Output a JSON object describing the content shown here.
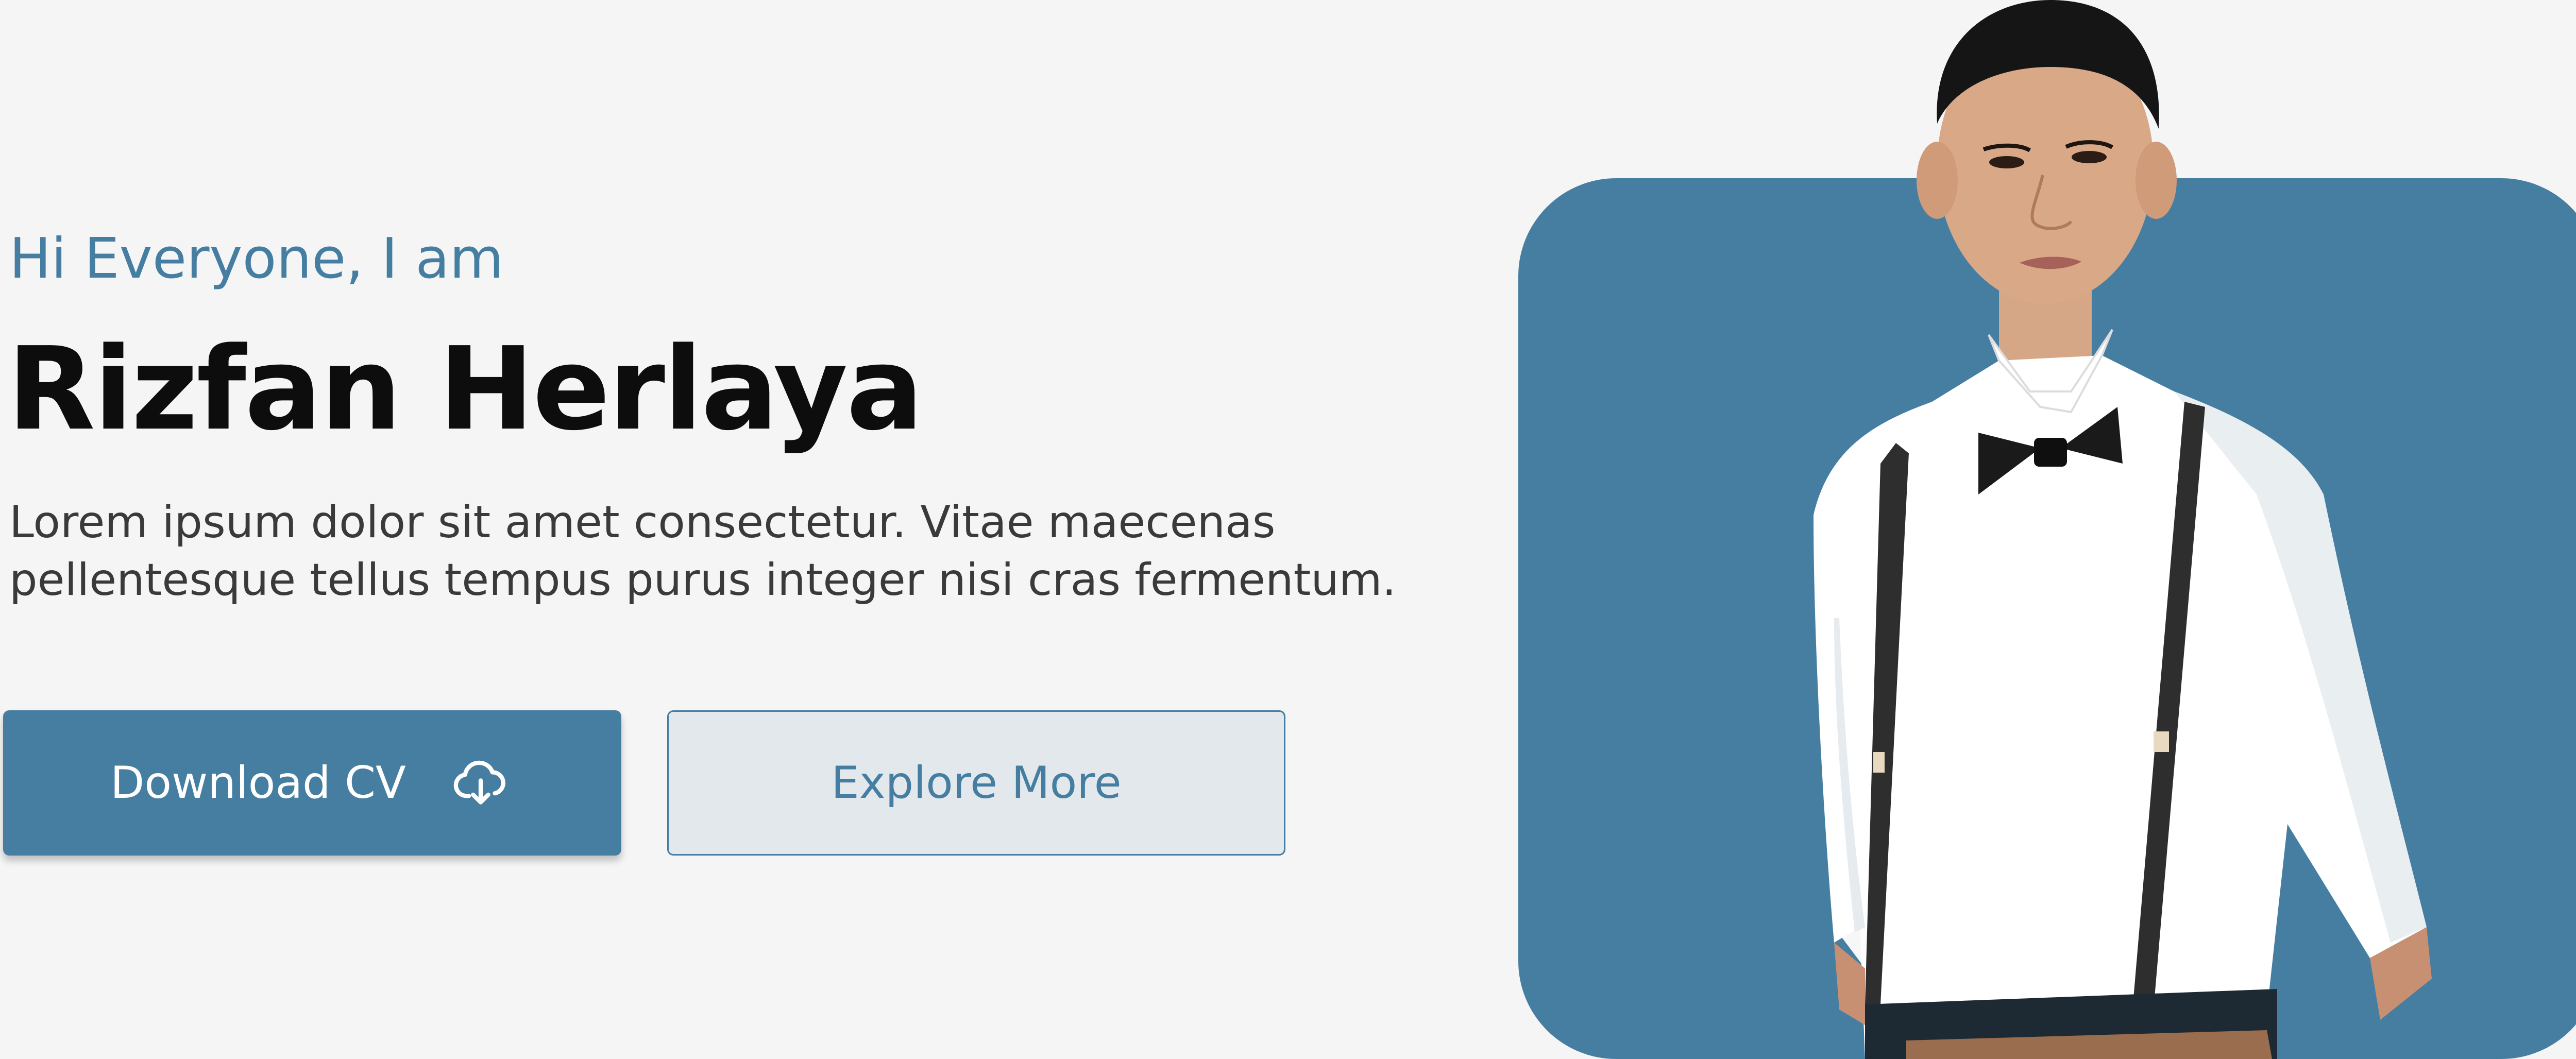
{
  "hero": {
    "greeting": "Hi Everyone, I am",
    "name": "Rizfan Herlaya",
    "description": "Lorem ipsum dolor sit amet consectetur. Vitae maecenas pellentesque tellus tempus purus integer nisi cras fermentum.",
    "buttons": {
      "download_label": "Download CV",
      "download_icon": "cloud-download-icon",
      "explore_label": "Explore More"
    },
    "photo": {
      "alt": "Portrait photo"
    }
  },
  "colors": {
    "accent": "#467ea1",
    "background": "#f5f5f5",
    "heading": "#0d0d0d",
    "body_text": "#3a3a3a",
    "secondary_button_bg": "#e3e8ed"
  }
}
